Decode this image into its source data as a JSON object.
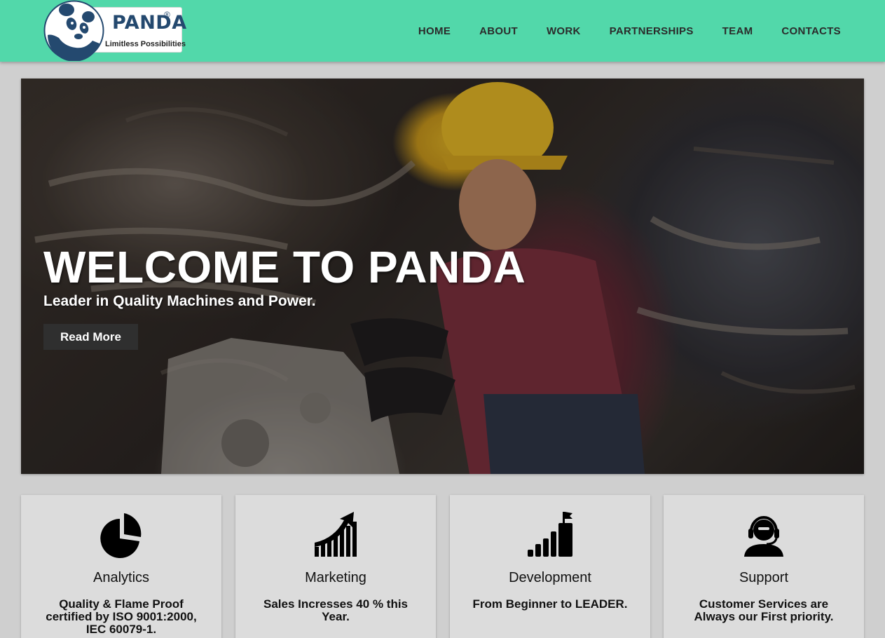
{
  "logo": {
    "name": "PANDA",
    "registered": "®",
    "tagline": "Limitless Possibilities"
  },
  "nav": {
    "items": [
      "HOME",
      "ABOUT",
      "WORK",
      "PARTNERSHIPS",
      "TEAM",
      "CONTACTS"
    ]
  },
  "hero": {
    "title": "WELCOME TO PANDA",
    "subtitle": "Leader in Quality Machines and Power.",
    "button_label": "Read More"
  },
  "cards": [
    {
      "icon": "pie-chart-icon",
      "title": "Analytics",
      "text": "Quality & Flame Proof certified by ISO 9001:2000, IEC 60079-1."
    },
    {
      "icon": "growth-chart-icon",
      "title": "Marketing",
      "text": "Sales Incresses 40 % this Year."
    },
    {
      "icon": "bars-flag-icon",
      "title": "Development",
      "text": "From Beginner to LEADER."
    },
    {
      "icon": "headset-support-icon",
      "title": "Support",
      "text": "Customer Services are Always our First priority."
    }
  ],
  "colors": {
    "header_bg": "#52d8aa",
    "logo_blue": "#24496f",
    "page_bg": "#cfcfcf",
    "card_bg": "#dcdcdc",
    "button_bg": "#2f2f2f"
  }
}
